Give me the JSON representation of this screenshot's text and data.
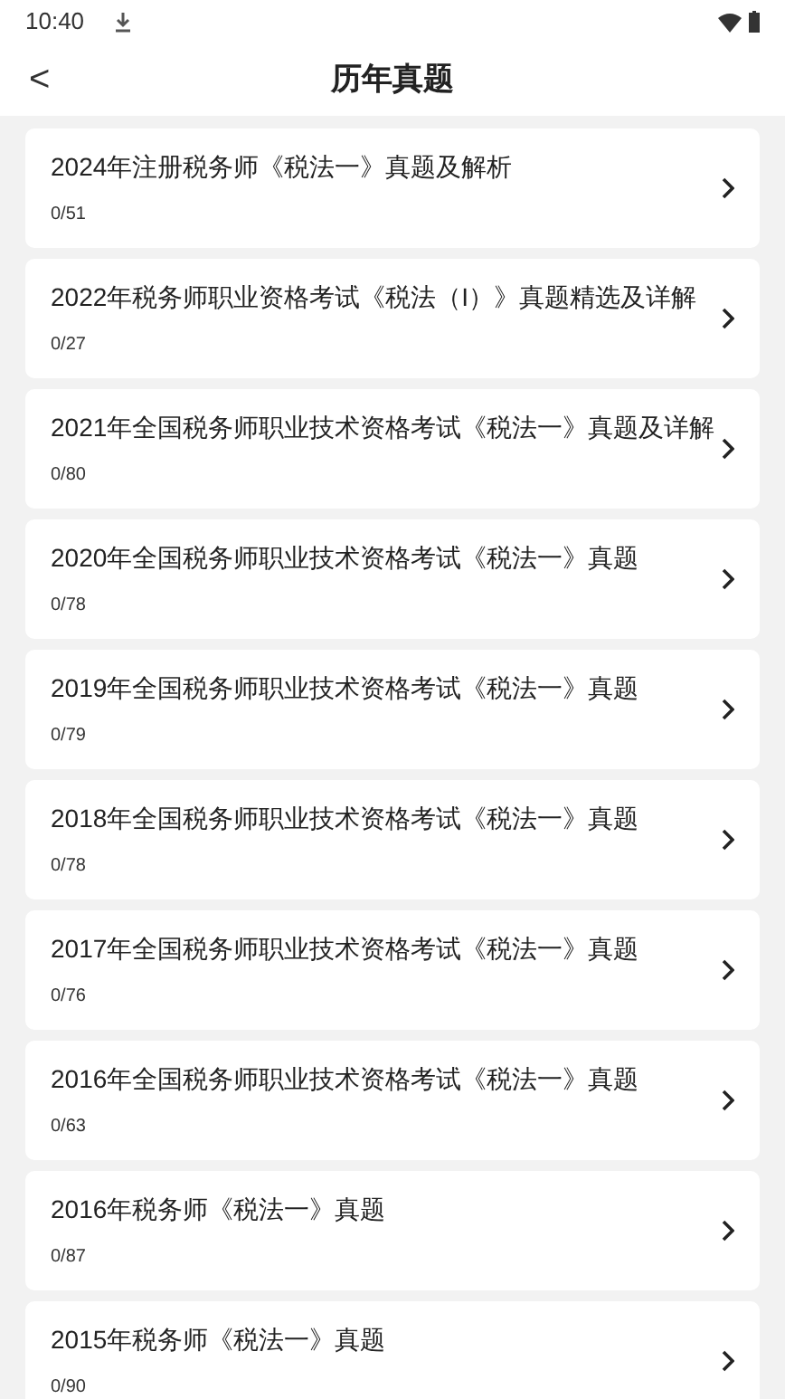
{
  "status_bar": {
    "time": "10:40"
  },
  "header": {
    "title": "历年真题",
    "back": "<"
  },
  "papers": [
    {
      "title": "2024年注册税务师《税法一》真题及解析",
      "progress": "0/51"
    },
    {
      "title": "2022年税务师职业资格考试《税法（I）》真题精选及详解",
      "progress": "0/27"
    },
    {
      "title": "2021年全国税务师职业技术资格考试《税法一》真题及详解",
      "progress": "0/80"
    },
    {
      "title": "2020年全国税务师职业技术资格考试《税法一》真题",
      "progress": "0/78"
    },
    {
      "title": "2019年全国税务师职业技术资格考试《税法一》真题",
      "progress": "0/79"
    },
    {
      "title": "2018年全国税务师职业技术资格考试《税法一》真题",
      "progress": "0/78"
    },
    {
      "title": "2017年全国税务师职业技术资格考试《税法一》真题",
      "progress": "0/76"
    },
    {
      "title": "2016年全国税务师职业技术资格考试《税法一》真题",
      "progress": "0/63"
    },
    {
      "title": "2016年税务师《税法一》真题",
      "progress": "0/87"
    },
    {
      "title": "2015年税务师《税法一》真题",
      "progress": "0/90"
    }
  ]
}
